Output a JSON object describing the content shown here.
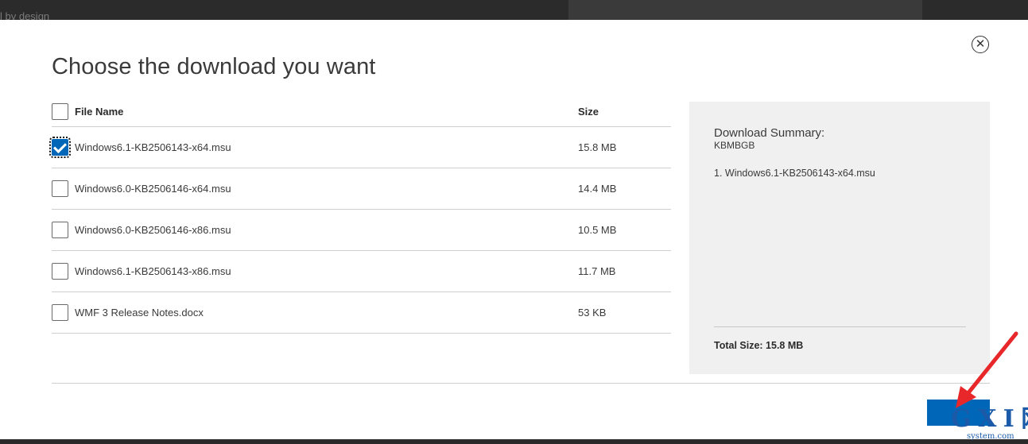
{
  "background": {
    "top_text": "l by design"
  },
  "dialog": {
    "title": "Choose the download you want",
    "close_label": "✕"
  },
  "table": {
    "headers": {
      "name": "File Name",
      "size": "Size"
    },
    "rows": [
      {
        "name": "Windows6.1-KB2506143-x64.msu",
        "size": "15.8 MB",
        "checked": true
      },
      {
        "name": "Windows6.0-KB2506146-x64.msu",
        "size": "14.4 MB",
        "checked": false
      },
      {
        "name": "Windows6.0-KB2506146-x86.msu",
        "size": "10.5 MB",
        "checked": false
      },
      {
        "name": "Windows6.1-KB2506143-x86.msu",
        "size": "11.7 MB",
        "checked": false
      },
      {
        "name": "WMF 3 Release Notes.docx",
        "size": "53 KB",
        "checked": false
      }
    ]
  },
  "summary": {
    "title": "Download Summary:",
    "subtitle": "KBMBGB",
    "items": [
      "1. Windows6.1-KB2506143-x64.msu"
    ],
    "total": "Total Size: 15.8 MB"
  },
  "next_button": {
    "label": ""
  },
  "watermark": {
    "big": "G X I 网",
    "small": "system.com"
  },
  "colors": {
    "accent": "#0067b8",
    "summary_bg": "#f0f0f0",
    "annotation_arrow": "#e8272a",
    "watermark": "#1a5aa8"
  }
}
